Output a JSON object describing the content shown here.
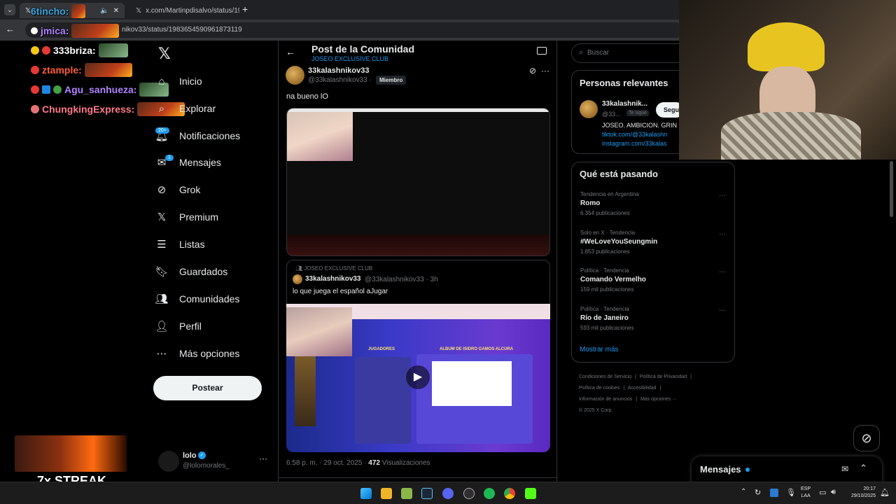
{
  "browser": {
    "tab1_title": "",
    "tab2_title": "x.com/Martinpdisalvo/status/19",
    "url": "nikov33/status/1983654590961873119",
    "new_tab_symbol": "+"
  },
  "chat": {
    "lines": [
      {
        "user": "6tincho:",
        "color": "#3aa8e0"
      },
      {
        "user": "jmica:",
        "color": "#b084ff"
      },
      {
        "user": "333briza:",
        "color": "#ffffff"
      },
      {
        "user": "ztample:",
        "color": "#ff5c3a"
      },
      {
        "user": "Agu_sanhueza:",
        "color": "#b084ff"
      },
      {
        "user": "ChungkingExpress:",
        "color": "#ff7a8a"
      }
    ],
    "streak": "7x STREAK"
  },
  "nav": {
    "items": [
      {
        "label": "Inicio",
        "icon": "home-icon"
      },
      {
        "label": "Explorar",
        "icon": "search-icon"
      },
      {
        "label": "Notificaciones",
        "icon": "bell-icon",
        "badge": "20+"
      },
      {
        "label": "Mensajes",
        "icon": "mail-icon",
        "badge": "1"
      },
      {
        "label": "Grok",
        "icon": "grok-icon"
      },
      {
        "label": "Premium",
        "icon": "x-icon"
      },
      {
        "label": "Listas",
        "icon": "list-icon"
      },
      {
        "label": "Guardados",
        "icon": "bookmark-icon"
      },
      {
        "label": "Comunidades",
        "icon": "people-icon"
      },
      {
        "label": "Perfil",
        "icon": "person-icon"
      },
      {
        "label": "Más opciones",
        "icon": "more-circle-icon"
      }
    ],
    "post_button": "Postear",
    "account_name": "lolo",
    "account_handle": "@lolomorales_"
  },
  "post": {
    "header_title": "Post de la Comunidad",
    "community": "JOSEO EXCLUSIVE CLUB",
    "author_name": "33kalashnikov33",
    "author_handle": "@33kalashnikov33",
    "separator": "·",
    "member_badge": "Miembro",
    "text": "na bueno lO",
    "quote": {
      "community": "JOSEO EXCLUSIVE CLUB",
      "author_name": "33kalashnikov33",
      "author_handle": "@33kalashnikov33",
      "time": "· 3h",
      "text": "lo que juega el español aJugar",
      "video_title": "ALBUM DE ISIDRO GAMOS ALCURA",
      "video_subtitle": "JUGADORES"
    },
    "timestamp": "6:58 p. m. · 29 oct. 2025 ·",
    "views_count": "472",
    "views_label": "Visualizaciones"
  },
  "right": {
    "search_placeholder": "Buscar",
    "relevant_title": "Personas relevantes",
    "relevant_name": "33kalashnik...",
    "relevant_handle": "@33...",
    "follows_you": "Te sigue",
    "follow_button": "Segu",
    "bio_line": "JOSEO. AMBICION. GRIN",
    "bio_link1": "tiktok.com/@33kalashn",
    "bio_link2": "instagram.com/33kalas",
    "trends_title": "Qué está pasando",
    "trends": [
      {
        "category": "Tendencia en Argentina",
        "name": "Romo",
        "count": "6.354 publicaciones"
      },
      {
        "category": "Solo en X · Tendencia",
        "name": "#WeLoveYouSeungmin",
        "count": "1.853 publicaciones"
      },
      {
        "category": "Política · Tendencia",
        "name": "Comando Vermelho",
        "count": "159 mil publicaciones"
      },
      {
        "category": "Política · Tendencia",
        "name": "Río de Janeiro",
        "count": "593 mil publicaciones"
      }
    ],
    "show_more": "Mostrar más",
    "footer_links": [
      "Condiciones de Servicio",
      "Política de Privacidad",
      "Política de cookies",
      "Accesibilidad",
      "Información de anuncios",
      "Más opciones ···"
    ],
    "copyright": "© 2025 X Corp."
  },
  "messages_dock": {
    "title": "Mensajes"
  },
  "taskbar": {
    "lang1": "ESP",
    "lang2": "LAA",
    "time": "20:17",
    "date": "29/10/2025"
  },
  "colors": {
    "accent": "#1d9bf0",
    "border": "#2f3336"
  }
}
